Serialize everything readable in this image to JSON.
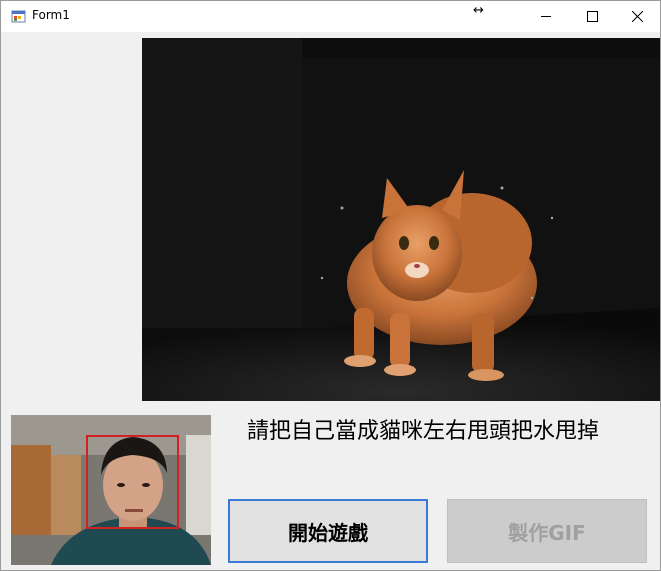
{
  "window": {
    "title": "Form1",
    "icon": "windows-form-icon",
    "controls": [
      "minimize-icon",
      "maximize-icon",
      "close-icon"
    ]
  },
  "game": {
    "instruction": "請把自己當成貓咪左右甩頭把水甩掉",
    "start_button": "開始遊戲",
    "gif_button": "製作GIF",
    "gif_button_enabled": false
  },
  "colors": {
    "face_box": "#d42020",
    "start_button_border": "#3a7bd5",
    "window_bg": "#f0f0f0"
  }
}
